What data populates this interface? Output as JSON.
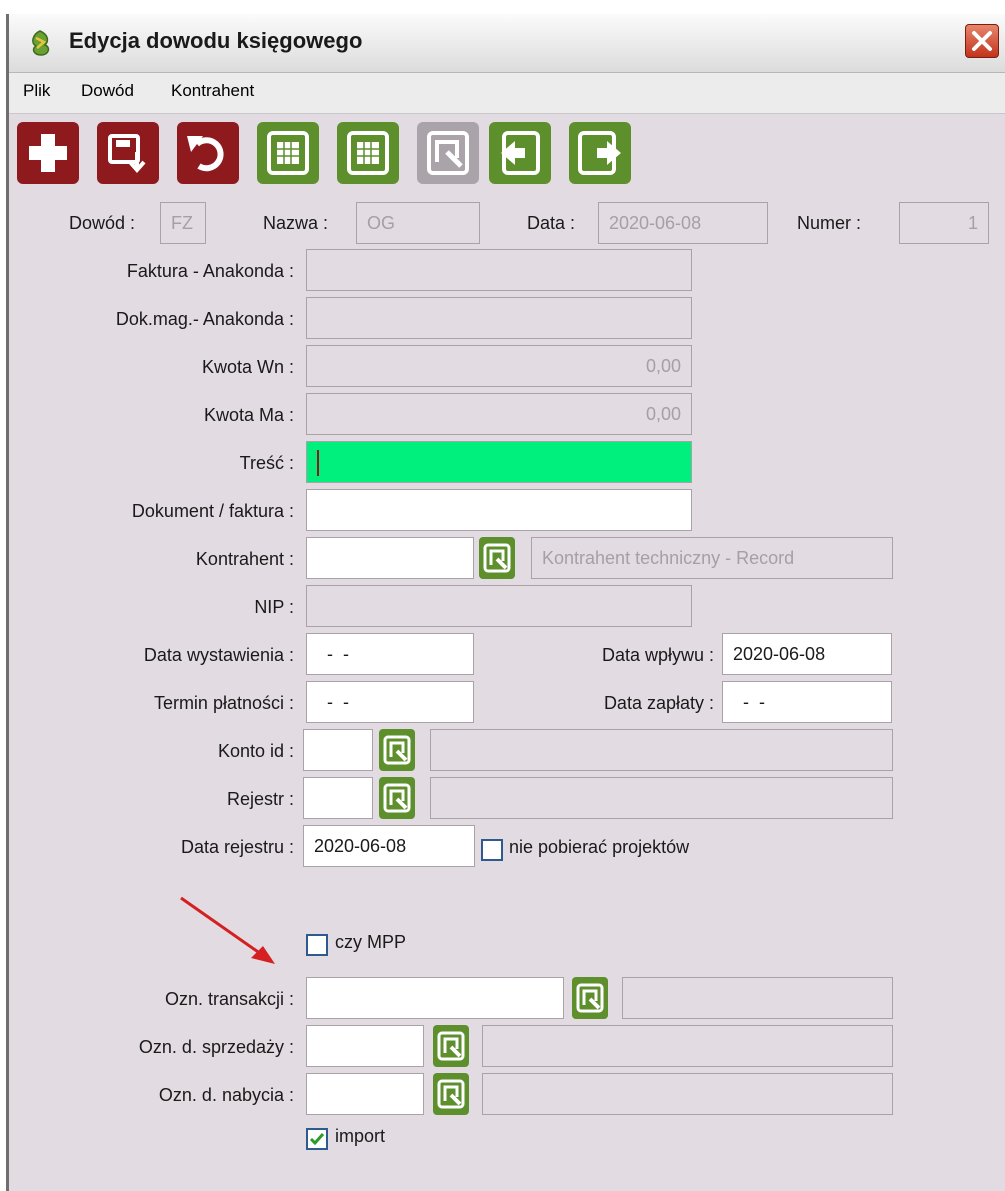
{
  "window": {
    "title": "Edycja dowodu księgowego"
  },
  "menu": [
    "Plik",
    "Dowód",
    "Kontrahent"
  ],
  "toolbar": [
    {
      "icon": "plus-icon",
      "color": "#8f1a1e"
    },
    {
      "icon": "save-icon",
      "color": "#8f1a1e"
    },
    {
      "icon": "undo-icon",
      "color": "#8f1a1e"
    },
    {
      "icon": "calculator-icon",
      "color": "#5d8f2d"
    },
    {
      "icon": "calculator-icon",
      "color": "#5d8f2d"
    },
    {
      "icon": "search-icon",
      "color": "#aaa4aa"
    },
    {
      "icon": "import-icon",
      "color": "#5d8f2d"
    },
    {
      "icon": "export-icon",
      "color": "#5d8f2d"
    }
  ],
  "header": {
    "dowod_label": "Dowód :",
    "dowod_value": "FZ",
    "nazwa_label": "Nazwa :",
    "nazwa_value": "OG",
    "data_label": "Data :",
    "data_value": "2020-06-08",
    "numer_label": "Numer :",
    "numer_value": "1"
  },
  "form": {
    "faktura_anakonda_label": "Faktura - Anakonda :",
    "faktura_anakonda_value": "",
    "dok_mag_label": "Dok.mag.- Anakonda :",
    "dok_mag_value": "",
    "kwota_wn_label": "Kwota Wn :",
    "kwota_wn_value": "0,00",
    "kwota_ma_label": "Kwota Ma :",
    "kwota_ma_value": "0,00",
    "tresc_label": "Treść :",
    "tresc_value": "",
    "dokument_label": "Dokument / faktura :",
    "dokument_value": "",
    "kontrahent_label": "Kontrahent :",
    "kontrahent_value": "",
    "kontrahent_name": "Kontrahent techniczny - Record",
    "nip_label": "NIP :",
    "nip_value": "",
    "data_wystawienia_label": "Data wystawienia :",
    "data_wystawienia_value": "  -  -",
    "data_wplywu_label": "Data wpływu :",
    "data_wplywu_value": "2020-06-08",
    "termin_platnosci_label": "Termin płatności :",
    "termin_platnosci_value": "  -  -",
    "data_zaplaty_label": "Data zapłaty :",
    "data_zaplaty_value": "  -  -",
    "konto_id_label": "Konto id :",
    "konto_id_value": "",
    "konto_id_desc": "",
    "rejestr_label": "Rejestr :",
    "rejestr_value": "",
    "rejestr_desc": "",
    "data_rejestru_label": "Data rejestru :",
    "data_rejestru_value": "2020-06-08",
    "nie_pobierac_label": "nie pobierać projektów",
    "nie_pobierac_checked": false,
    "czy_mpp_label": "czy MPP",
    "czy_mpp_checked": false,
    "ozn_transakcji_label": "Ozn. transakcji :",
    "ozn_transakcji_value": "",
    "ozn_transakcji_desc": "",
    "ozn_sprzedazy_label": "Ozn. d. sprzedaży :",
    "ozn_sprzedazy_value": "",
    "ozn_sprzedazy_desc": "",
    "ozn_nabycia_label": "Ozn. d. nabycia :",
    "ozn_nabycia_value": "",
    "ozn_nabycia_desc": "",
    "import_label": "import",
    "import_checked": true
  },
  "colors": {
    "active_field": "#00f07d",
    "window_bg": "#e2dbe2",
    "annotation_arrow": "#d42020"
  }
}
